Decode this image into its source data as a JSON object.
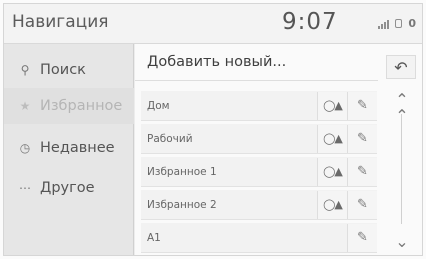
{
  "header": {
    "title": "Навигация",
    "time": "9:07",
    "status_number": "0"
  },
  "sidebar": {
    "items": [
      {
        "label": "Поиск",
        "icon": "search-icon",
        "active": false
      },
      {
        "label": "Избранное",
        "icon": "star-icon",
        "active": true
      },
      {
        "label": "Недавнее",
        "icon": "clock-icon",
        "active": false
      },
      {
        "label": "Другое",
        "icon": "more-icon",
        "active": false
      }
    ]
  },
  "main": {
    "add_label": "Добавить новый...",
    "rows": [
      {
        "name": "Дом",
        "has_route": true
      },
      {
        "name": "Рабочий",
        "has_route": true
      },
      {
        "name": "Избранное 1",
        "has_route": true
      },
      {
        "name": "Избранное 2",
        "has_route": true
      },
      {
        "name": "A1",
        "has_route": false
      }
    ]
  },
  "controls": {
    "back_icon": "back-arrow-icon",
    "scroll_up_icon": "double-chevron-up-icon",
    "scroll_down_icon": "double-chevron-down-icon"
  }
}
